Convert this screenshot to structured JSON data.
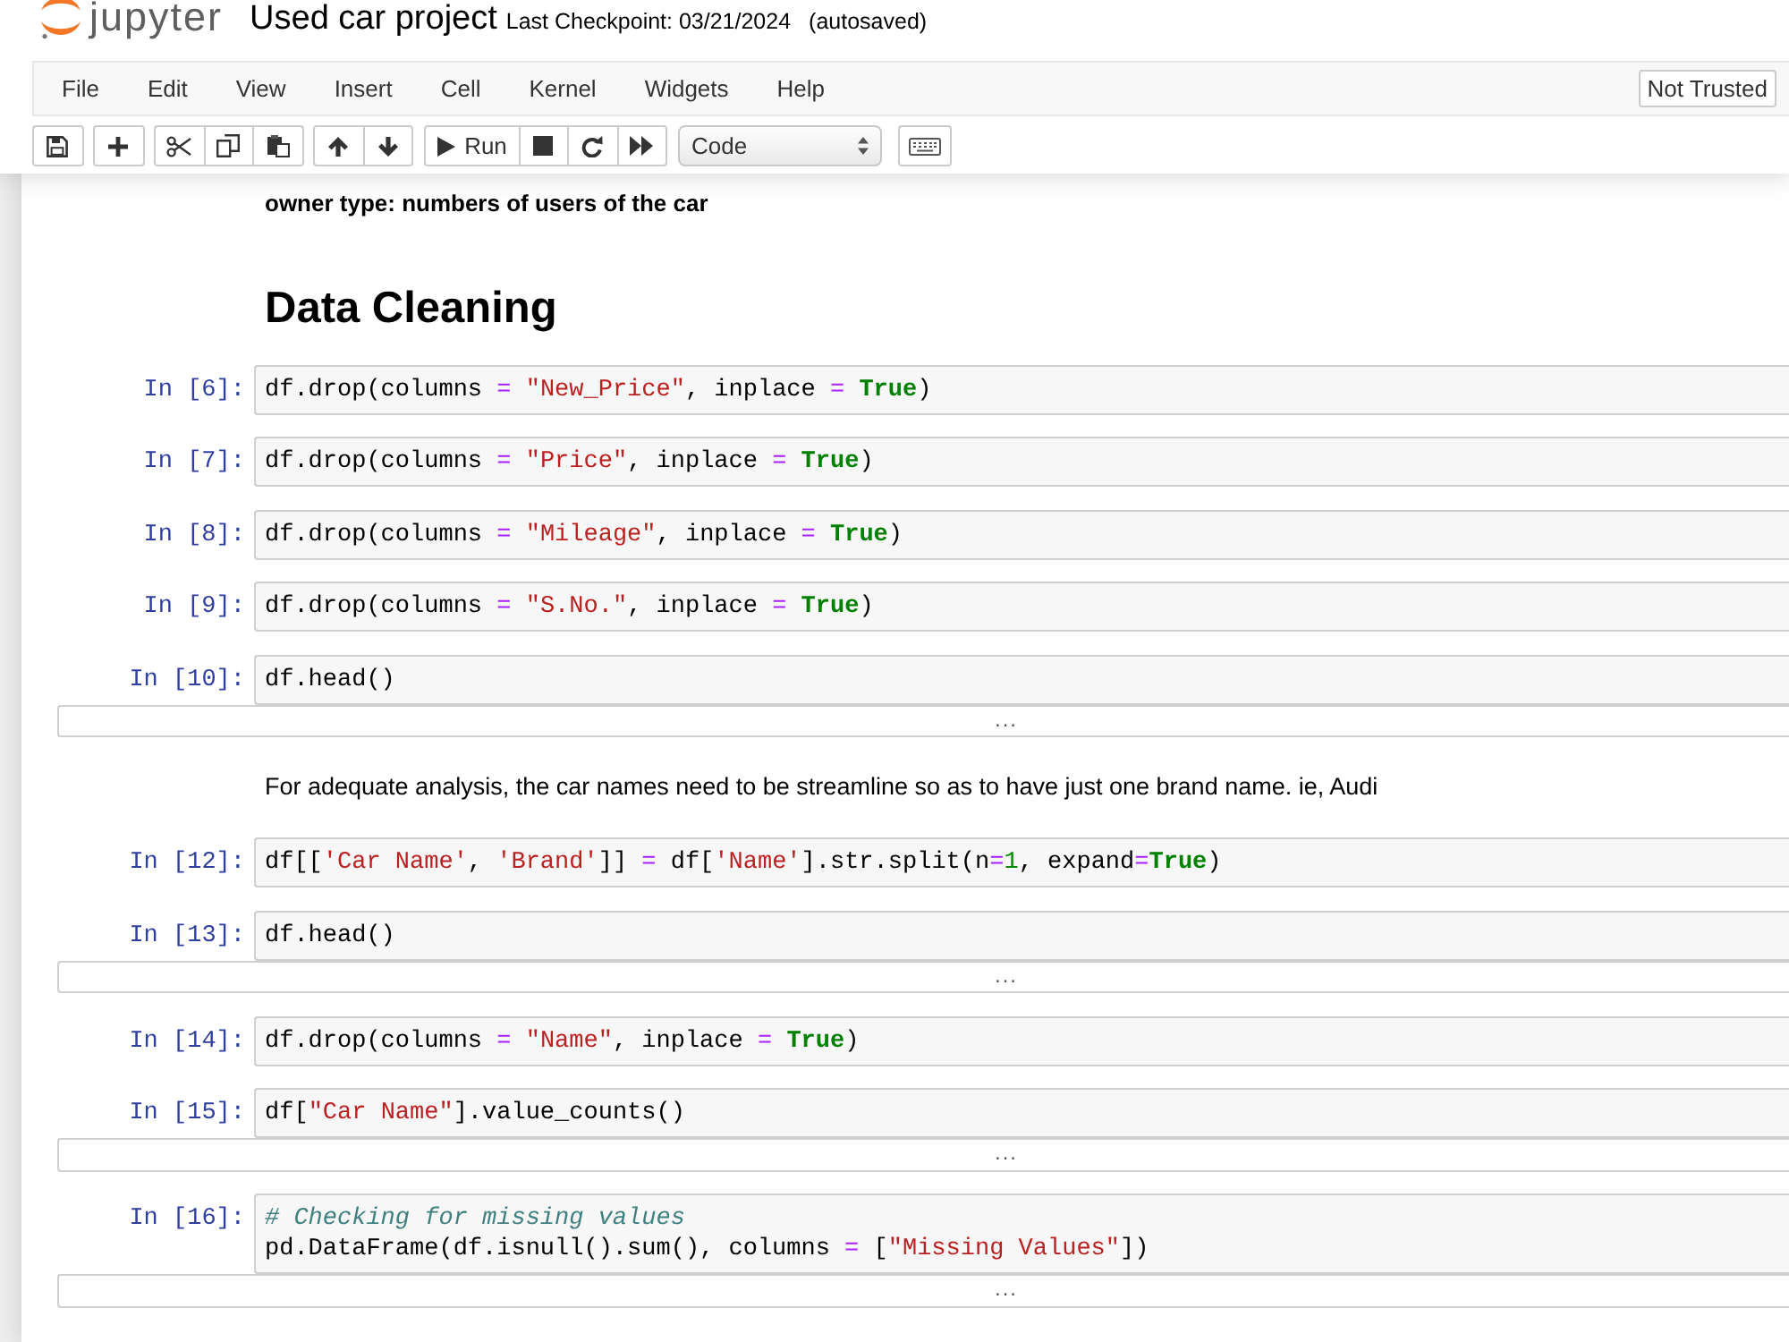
{
  "header": {
    "logo_text": "jupyter",
    "title": "Used car project",
    "checkpoint": "Last Checkpoint: 03/21/2024",
    "autosave_status": "(autosaved)"
  },
  "menu_bar": {
    "items": [
      "File",
      "Edit",
      "View",
      "Insert",
      "Cell",
      "Kernel",
      "Widgets",
      "Help"
    ],
    "trust_status": "Not Trusted"
  },
  "toolbar": {
    "run_label": "Run",
    "cell_type": "Code"
  },
  "cells": [
    {
      "kind": "markdown",
      "bold": true,
      "text": "owner type: numbers of users of the car"
    },
    {
      "kind": "heading",
      "text": "Data Cleaning"
    },
    {
      "kind": "code",
      "prompt": "In [6]:",
      "lines": [
        [
          {
            "text": "df.drop(columns",
            "kind": "plain"
          },
          {
            "text": " = ",
            "kind": "operator"
          },
          {
            "text": "\"New_Price\"",
            "kind": "string"
          },
          {
            "text": ", inplace",
            "kind": "plain"
          },
          {
            "text": " = ",
            "kind": "operator"
          },
          {
            "text": "True",
            "kind": "keyword"
          },
          {
            "text": ")",
            "kind": "plain"
          }
        ]
      ]
    },
    {
      "kind": "code",
      "prompt": "In [7]:",
      "lines": [
        [
          {
            "text": "df.drop(columns",
            "kind": "plain"
          },
          {
            "text": " = ",
            "kind": "operator"
          },
          {
            "text": "\"Price\"",
            "kind": "string"
          },
          {
            "text": ", inplace",
            "kind": "plain"
          },
          {
            "text": " = ",
            "kind": "operator"
          },
          {
            "text": "True",
            "kind": "keyword"
          },
          {
            "text": ")",
            "kind": "plain"
          }
        ]
      ]
    },
    {
      "kind": "code",
      "prompt": "In [8]:",
      "lines": [
        [
          {
            "text": "df.drop(columns",
            "kind": "plain"
          },
          {
            "text": " = ",
            "kind": "operator"
          },
          {
            "text": "\"Mileage\"",
            "kind": "string"
          },
          {
            "text": ", inplace",
            "kind": "plain"
          },
          {
            "text": " = ",
            "kind": "operator"
          },
          {
            "text": "True",
            "kind": "keyword"
          },
          {
            "text": ")",
            "kind": "plain"
          }
        ]
      ]
    },
    {
      "kind": "code",
      "prompt": "In [9]:",
      "lines": [
        [
          {
            "text": "df.drop(columns",
            "kind": "plain"
          },
          {
            "text": " = ",
            "kind": "operator"
          },
          {
            "text": "\"S.No.\"",
            "kind": "string"
          },
          {
            "text": ", inplace",
            "kind": "plain"
          },
          {
            "text": " = ",
            "kind": "operator"
          },
          {
            "text": "True",
            "kind": "keyword"
          },
          {
            "text": ")",
            "kind": "plain"
          }
        ]
      ]
    },
    {
      "kind": "code",
      "prompt": "In [10]:",
      "lines": [
        [
          {
            "text": "df.head()",
            "kind": "plain"
          }
        ]
      ],
      "output": {
        "kind": "collapsed",
        "text": "..."
      }
    },
    {
      "kind": "markdown",
      "bold": false,
      "text": "For adequate analysis, the car names need to be streamline so as to have just one brand name. ie, Audi"
    },
    {
      "kind": "code",
      "prompt": "In [12]:",
      "lines": [
        [
          {
            "text": "df[[",
            "kind": "plain"
          },
          {
            "text": "'Car Name'",
            "kind": "string"
          },
          {
            "text": ", ",
            "kind": "plain"
          },
          {
            "text": "'Brand'",
            "kind": "string"
          },
          {
            "text": "]]",
            "kind": "plain"
          },
          {
            "text": " = ",
            "kind": "operator"
          },
          {
            "text": "df[",
            "kind": "plain"
          },
          {
            "text": "'Name'",
            "kind": "string"
          },
          {
            "text": "].str.split(n",
            "kind": "plain"
          },
          {
            "text": "=",
            "kind": "operator"
          },
          {
            "text": "1",
            "kind": "number"
          },
          {
            "text": ", expand",
            "kind": "plain"
          },
          {
            "text": "=",
            "kind": "operator"
          },
          {
            "text": "True",
            "kind": "keyword"
          },
          {
            "text": ")",
            "kind": "plain"
          }
        ]
      ]
    },
    {
      "kind": "code",
      "prompt": "In [13]:",
      "lines": [
        [
          {
            "text": "df.head()",
            "kind": "plain"
          }
        ]
      ],
      "output": {
        "kind": "collapsed",
        "text": "..."
      }
    },
    {
      "kind": "code",
      "prompt": "In [14]:",
      "lines": [
        [
          {
            "text": "df.drop(columns",
            "kind": "plain"
          },
          {
            "text": " = ",
            "kind": "operator"
          },
          {
            "text": "\"Name\"",
            "kind": "string"
          },
          {
            "text": ", inplace",
            "kind": "plain"
          },
          {
            "text": " = ",
            "kind": "operator"
          },
          {
            "text": "True",
            "kind": "keyword"
          },
          {
            "text": ")",
            "kind": "plain"
          }
        ]
      ]
    },
    {
      "kind": "code",
      "prompt": "In [15]:",
      "lines": [
        [
          {
            "text": "df[",
            "kind": "plain"
          },
          {
            "text": "\"Car Name\"",
            "kind": "string"
          },
          {
            "text": "].value_counts()",
            "kind": "plain"
          }
        ]
      ],
      "output": {
        "kind": "collapsed",
        "text": "..."
      }
    },
    {
      "kind": "code",
      "prompt": "In [16]:",
      "lines": [
        [
          {
            "text": "# Checking for missing values",
            "kind": "comment"
          }
        ],
        [
          {
            "text": "pd.DataFrame(df.isnull().sum(), columns",
            "kind": "plain"
          },
          {
            "text": " = ",
            "kind": "operator"
          },
          {
            "text": "[",
            "kind": "plain"
          },
          {
            "text": "\"Missing Values\"",
            "kind": "string"
          },
          {
            "text": "])",
            "kind": "plain"
          }
        ]
      ],
      "output": {
        "kind": "collapsed",
        "text": "..."
      }
    }
  ]
}
